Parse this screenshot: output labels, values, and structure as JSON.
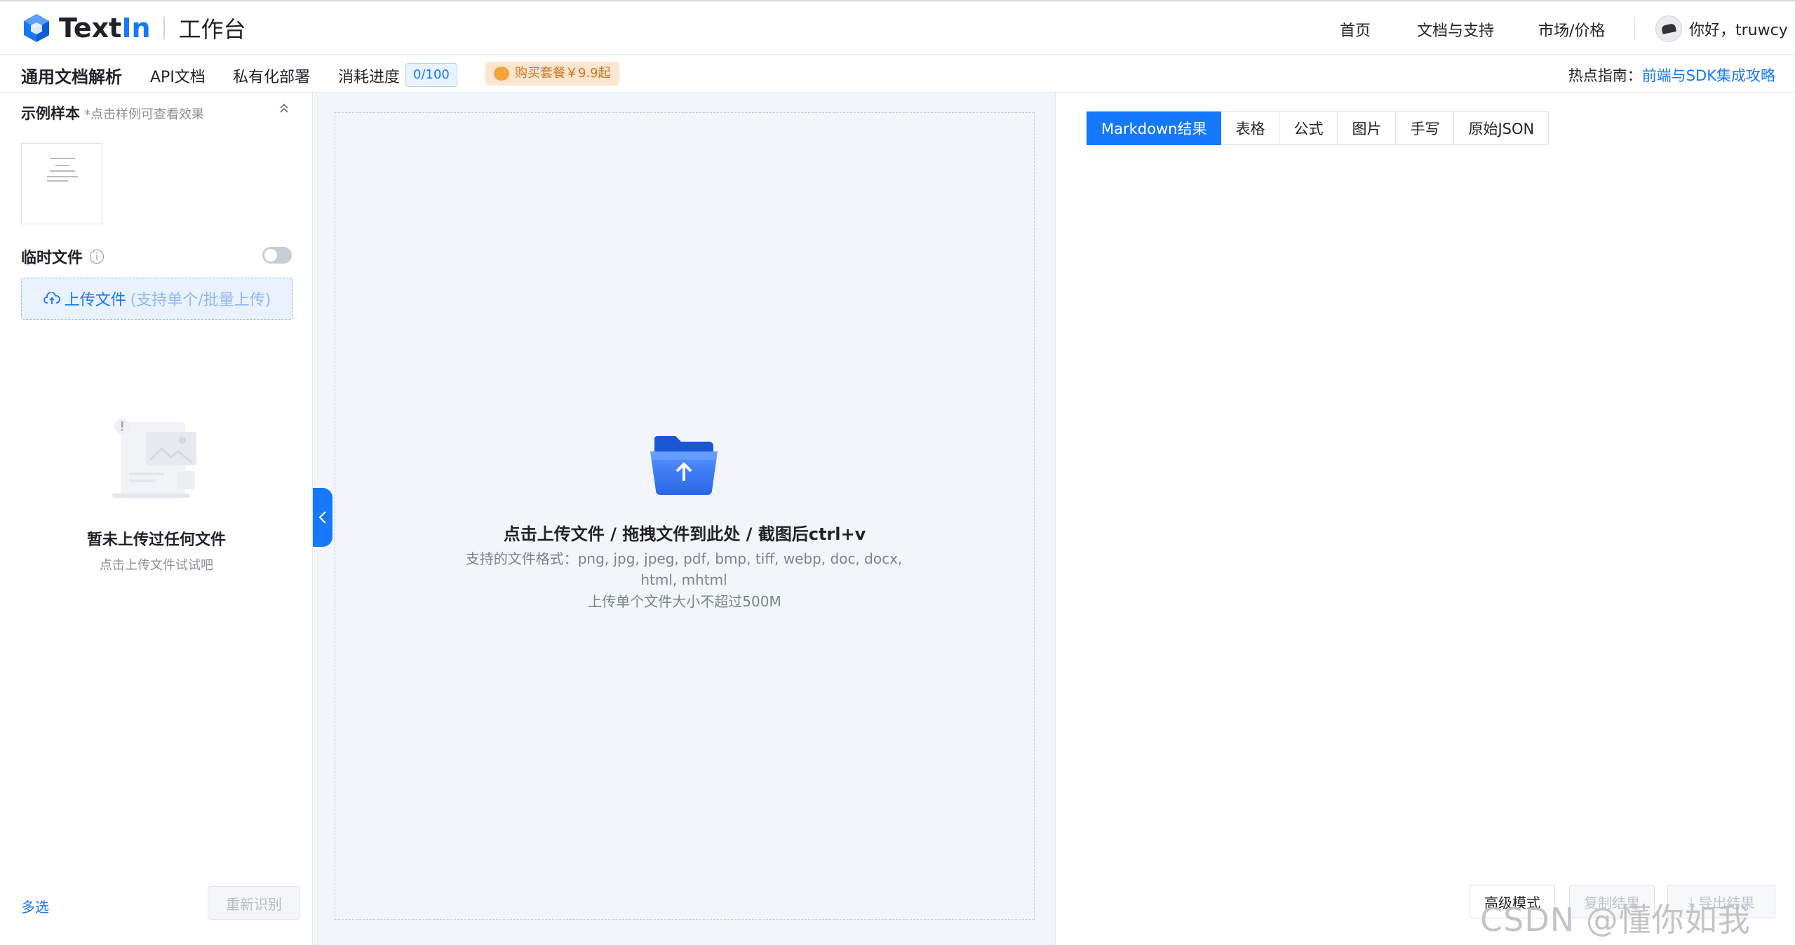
{
  "header": {
    "logo_text": "Text",
    "logo_accent": "In",
    "logo_sub": "工作台",
    "nav": [
      "首页",
      "文档与支持",
      "市场/价格"
    ],
    "user_greeting": "你好，truwcy"
  },
  "subnav": {
    "active": "通用文档解析",
    "items": [
      "API文档",
      "私有化部署",
      "消耗进度"
    ],
    "usage": "0/100",
    "buy": "购买套餐￥9.9起",
    "hot_label": "热点指南：",
    "hot_link": "前端与SDK集成攻略"
  },
  "sidebar": {
    "sample_title": "示例样本",
    "sample_hint": "*点击样例可查看效果",
    "temp_files": "临时文件",
    "upload_label": "上传文件",
    "upload_hint": "(支持单个/批量上传)",
    "empty_title": "暂未上传过任何文件",
    "empty_sub": "点击上传文件试试吧",
    "multi_select": "多选",
    "reidentify": "重新识别"
  },
  "dropzone": {
    "title": "点击上传文件 / 拖拽文件到此处 / 截图后ctrl+v",
    "formats": "支持的文件格式：png, jpg, jpeg, pdf, bmp, tiff, webp, doc, docx, html, mhtml",
    "size": "上传单个文件大小不超过500M"
  },
  "result": {
    "tabs": [
      "Markdown结果",
      "表格",
      "公式",
      "图片",
      "手写",
      "原始JSON"
    ],
    "active_tab": 0,
    "advanced": "高级模式",
    "copy": "复制结果",
    "export": "导出结果"
  },
  "watermark": "CSDN @懂你如我",
  "colors": {
    "accent": "#1677ff",
    "badge_orange": "#d4721c"
  }
}
